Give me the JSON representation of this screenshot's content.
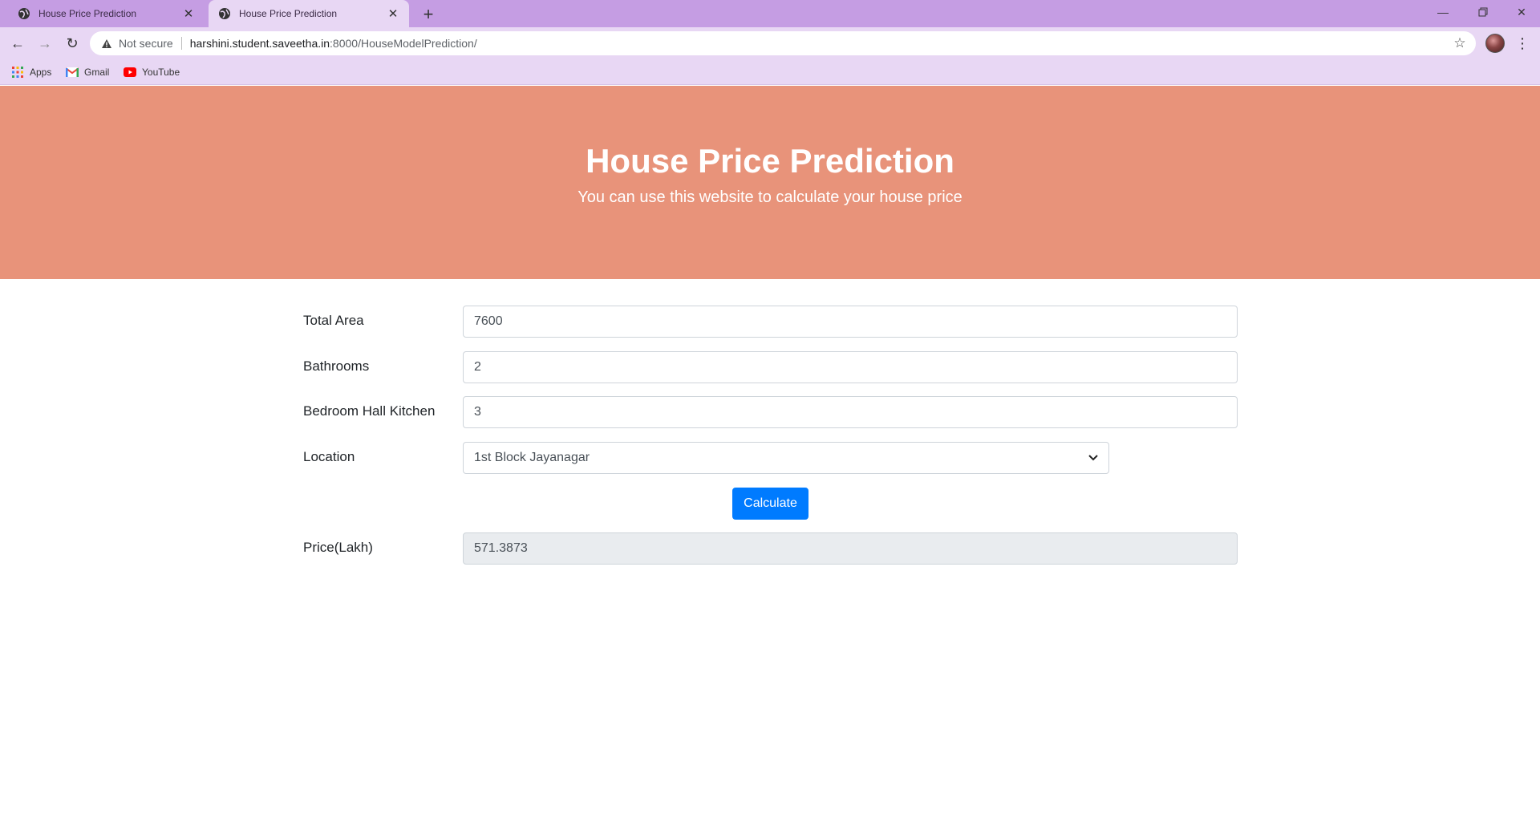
{
  "browser": {
    "tabs": [
      {
        "title": "House Price Prediction",
        "active": false
      },
      {
        "title": "House Price Prediction",
        "active": true
      }
    ],
    "new_tab_icon": "plus-icon",
    "window_controls": [
      "minimize-icon",
      "restore-icon",
      "close-icon"
    ],
    "address": {
      "security_text": "Not secure",
      "url_host": "harshini.student.saveetha.in",
      "url_path": ":8000/HouseModelPrediction/"
    },
    "bookmarks": [
      {
        "label": "Apps",
        "icon": "apps-grid-icon"
      },
      {
        "label": "Gmail",
        "icon": "gmail-icon"
      },
      {
        "label": "YouTube",
        "icon": "youtube-icon"
      }
    ]
  },
  "page": {
    "title": "House Price Prediction",
    "subtitle": "You can use this website to calculate your house price",
    "form": {
      "total_area": {
        "label": "Total Area",
        "value": "7600"
      },
      "bathrooms": {
        "label": "Bathrooms",
        "value": "2"
      },
      "bhk": {
        "label": "Bedroom Hall Kitchen",
        "value": "3"
      },
      "location": {
        "label": "Location",
        "selected": "1st Block Jayanagar"
      },
      "calculate_label": "Calculate",
      "price": {
        "label": "Price(Lakh)",
        "value": "571.3873"
      }
    }
  },
  "colors": {
    "tabbar": "#c59de3",
    "toolbar": "#e8d7f4",
    "hero": "#e8937a",
    "button": "#007bff"
  }
}
